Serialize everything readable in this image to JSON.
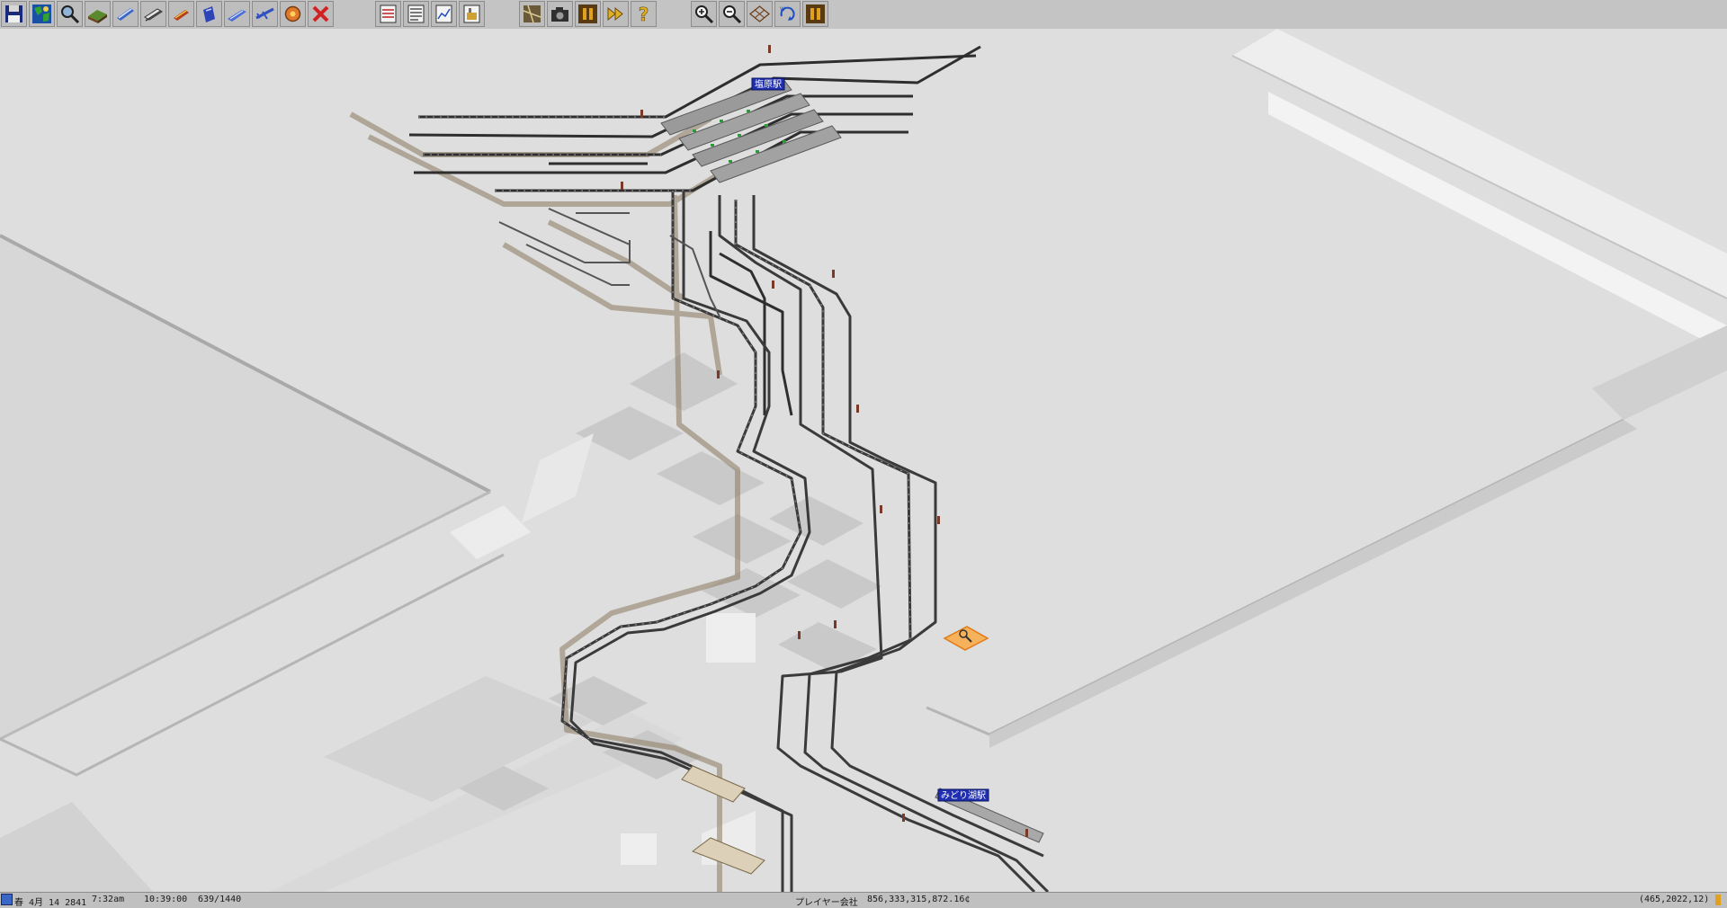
{
  "toolbar": {
    "groups": [
      {
        "name": "main-tools",
        "buttons": [
          {
            "icon": "disk-icon"
          },
          {
            "icon": "world-map-icon"
          },
          {
            "icon": "magnifier-icon"
          },
          {
            "icon": "terrain-icon"
          },
          {
            "icon": "rail-tools-icon"
          },
          {
            "icon": "monorail-icon"
          },
          {
            "icon": "road-tools-icon"
          },
          {
            "icon": "ship-tools-icon"
          },
          {
            "icon": "airport-tools-icon"
          },
          {
            "icon": "airplane-icon"
          },
          {
            "icon": "special-tools-icon"
          },
          {
            "icon": "remove-icon"
          }
        ]
      },
      {
        "name": "list-tools",
        "buttons": [
          {
            "icon": "line-management-icon"
          },
          {
            "icon": "list-icon"
          },
          {
            "icon": "finance-icon"
          },
          {
            "icon": "factory-list-icon"
          }
        ]
      },
      {
        "name": "view-tools",
        "buttons": [
          {
            "icon": "minimap-icon"
          },
          {
            "icon": "camera-icon"
          },
          {
            "icon": "pause-icon"
          },
          {
            "icon": "fast-forward-icon"
          },
          {
            "icon": "help-icon"
          }
        ]
      },
      {
        "name": "zoom-tools",
        "buttons": [
          {
            "icon": "zoom-in-icon"
          },
          {
            "icon": "zoom-out-icon"
          },
          {
            "icon": "grid-icon"
          },
          {
            "icon": "rotate-icon"
          },
          {
            "icon": "pause-icon"
          }
        ]
      }
    ]
  },
  "map": {
    "stations": [
      {
        "name": "塩原駅"
      },
      {
        "name": "みどり湖駅"
      }
    ]
  },
  "status": {
    "date": "春 4月 14 2841",
    "time": "7:32am",
    "ticks": "10:39:00",
    "counter": "639/1440",
    "player": "プレイヤー会社",
    "money": "856,333,315,872.16¢",
    "coords": "(465,2022,12)"
  },
  "colors": {
    "toolbar": "#c4c4c4",
    "ground": "#dedede",
    "rail": "#3a3a3a",
    "station_label_bg": "#1f2fb0",
    "cursor": "#f09a2a"
  }
}
